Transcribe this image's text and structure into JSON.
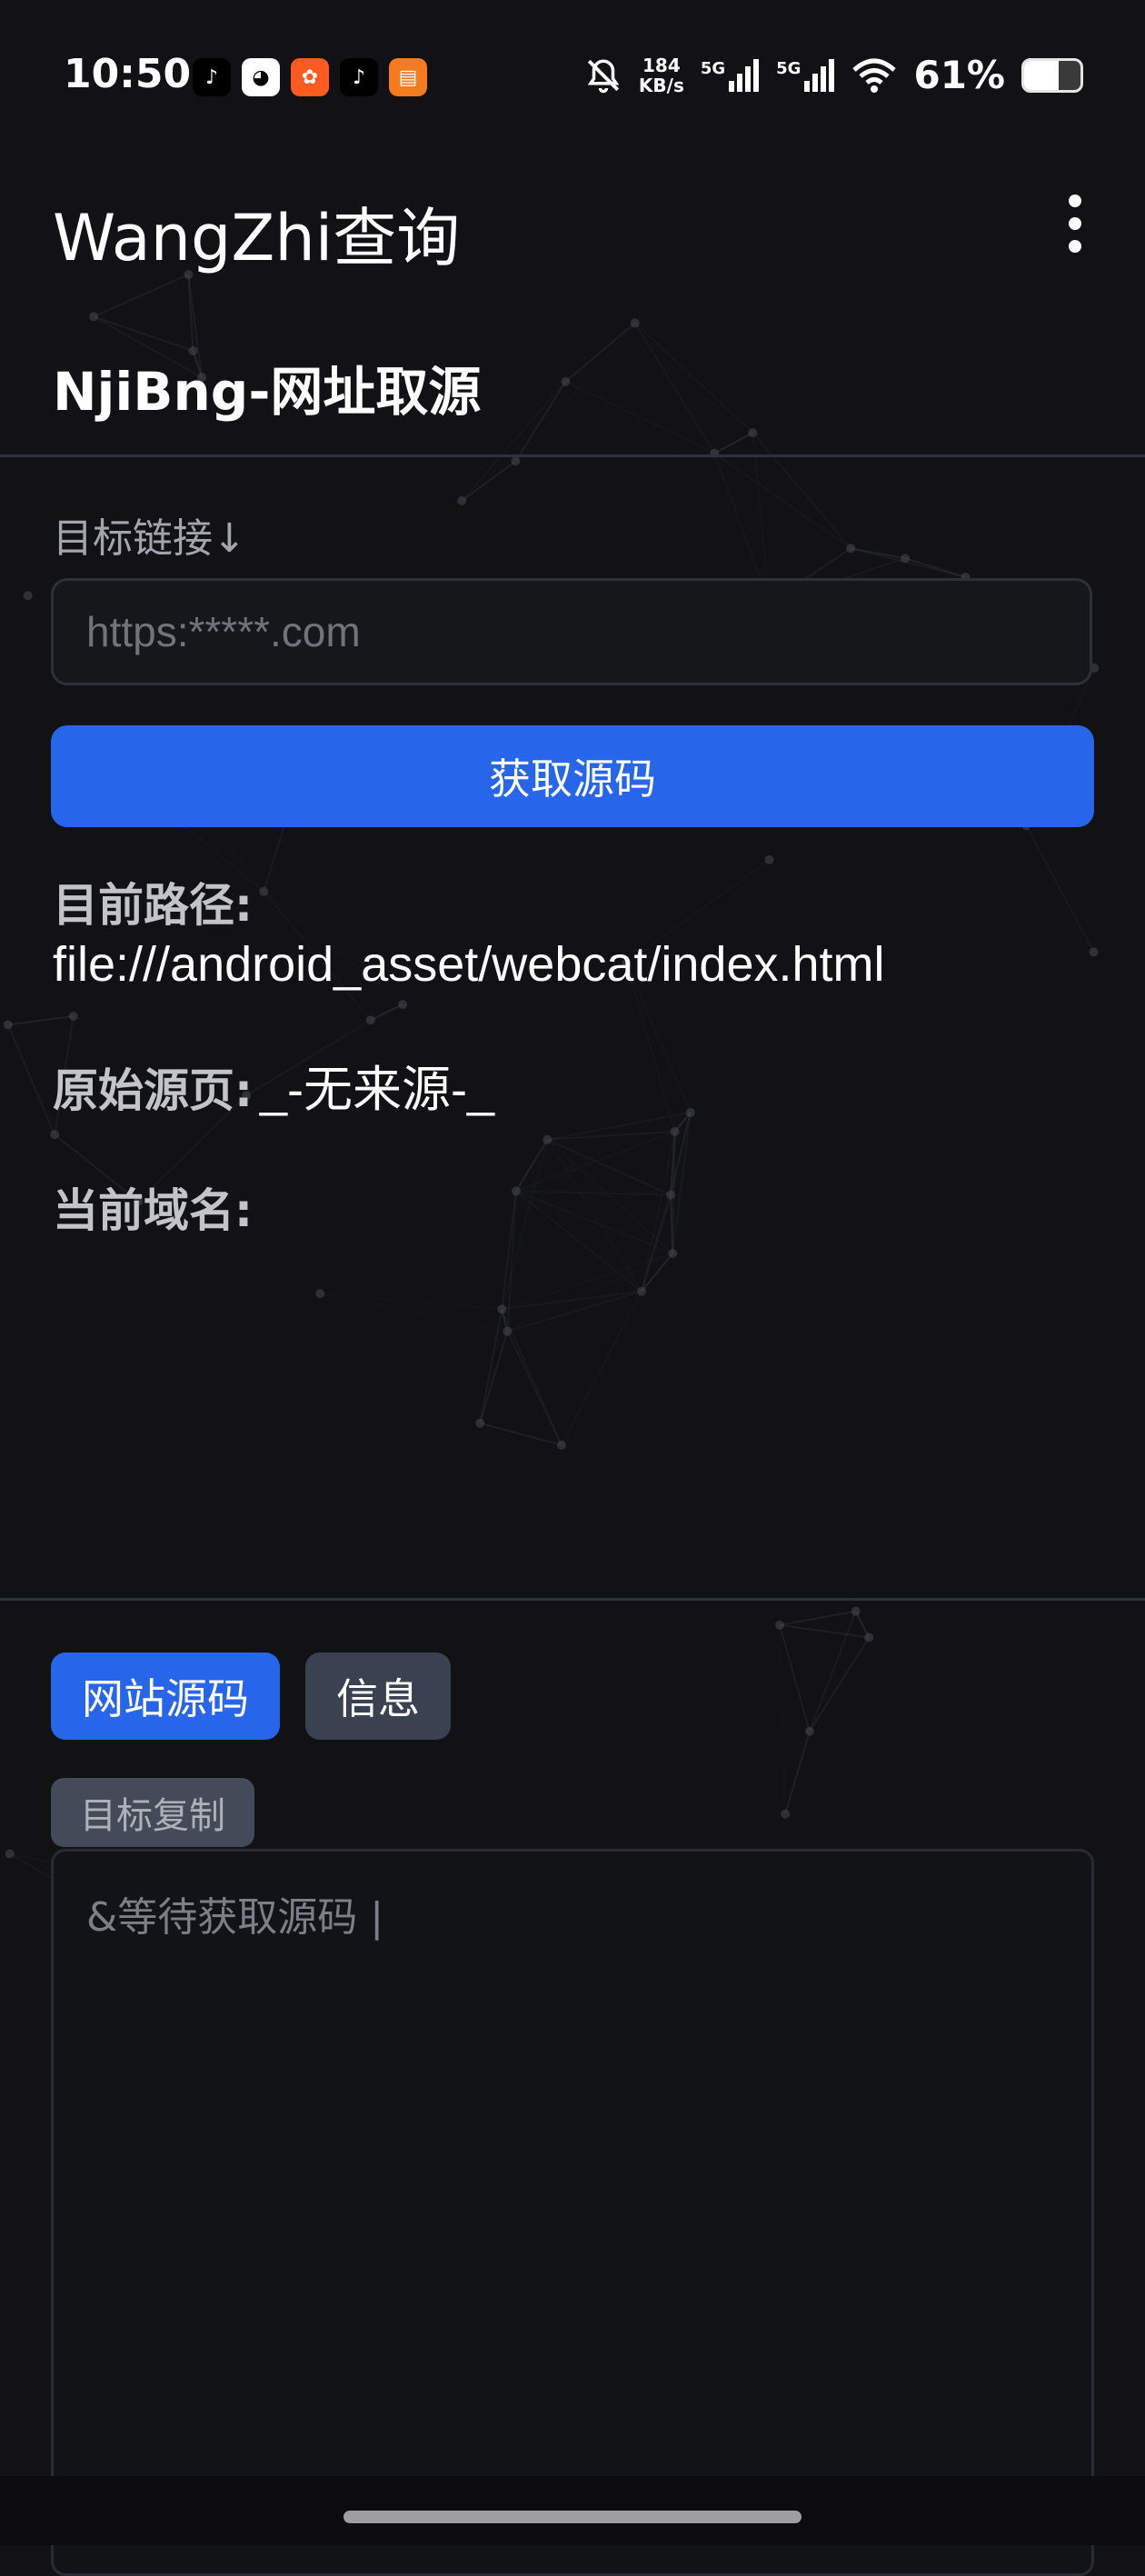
{
  "status_bar": {
    "time": "10:50",
    "apps": [
      {
        "icon": "tiktok-icon",
        "glyph": "♪",
        "color": "#000000"
      },
      {
        "icon": "qq-icon",
        "glyph": "◕",
        "color": "#ffffff"
      },
      {
        "icon": "kuaishou-icon",
        "glyph": "✿",
        "color": "#ff5a1f"
      },
      {
        "icon": "tiktok-icon",
        "glyph": "♪",
        "color": "#000000"
      },
      {
        "icon": "anti-fraud-app-icon",
        "glyph": "▤",
        "color": "#f47b20"
      }
    ],
    "net_speed_value": "184",
    "net_speed_unit": "KB/s",
    "signal_1": "5G",
    "signal_2": "5G",
    "battery_percent": "61%",
    "battery_level": 0.61
  },
  "app_bar": {
    "title": "WangZhi查询"
  },
  "page": {
    "subtitle": "NjiBng-网址取源"
  },
  "form": {
    "url_label": "目标链接↓",
    "url_value": "",
    "url_placeholder": "https:*****.com",
    "fetch_button": "获取源码"
  },
  "info": {
    "current_path_label": "目前路径:",
    "current_path_value": "file:///android_asset/webcat/index.html",
    "origin_label": "原始源页:",
    "origin_value": "_-无来源-_",
    "domain_label": "当前域名:",
    "domain_value": ""
  },
  "tabs": {
    "source": "网站源码",
    "info": "信息"
  },
  "source_panel": {
    "copy_button": "目标复制",
    "placeholder": "&等待获取源码 |",
    "value": ""
  },
  "colors": {
    "accent": "#2765ea",
    "background": "#121215",
    "secondary_button": "#3a4150"
  }
}
